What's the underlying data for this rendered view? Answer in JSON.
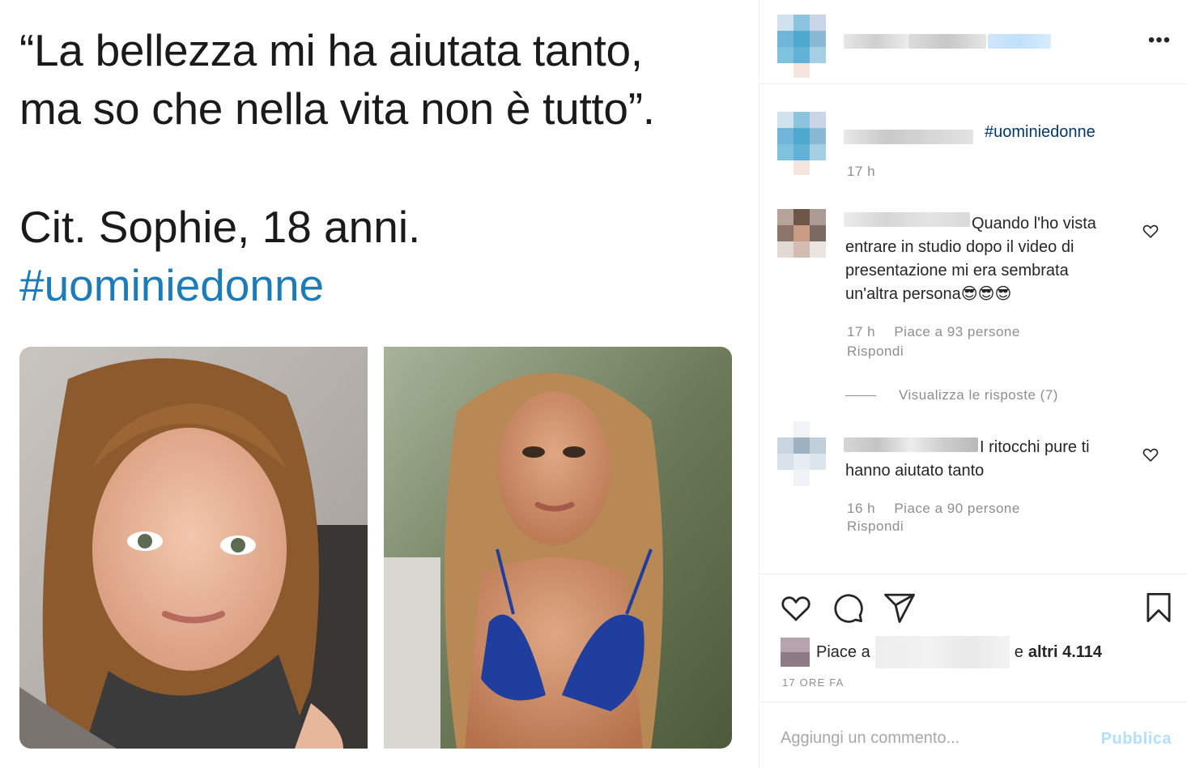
{
  "post": {
    "quote_line1": "“La bellezza mi ha aiutata tanto,",
    "quote_line2": "ma so che nella vita non è tutto”.",
    "citation": "Cit. Sophie, 18 anni.",
    "hashtag": "#uominiedonne",
    "images": [
      "selfie-photo",
      "bikini-photo"
    ]
  },
  "sidebar": {
    "more_icon": "more-options-icon",
    "caption": {
      "hashtag": "#uominiedonne",
      "time": "17 h"
    },
    "comments": [
      {
        "text": "Quando l'ho vista entrare in studio dopo il video di presentazione mi era sembrata un'altra persona😎😎😎",
        "time": "17 h",
        "likes": "Piace a 93 persone",
        "reply": "Rispondi",
        "view_replies": "Visualizza le risposte (7)"
      },
      {
        "text": "I ritocchi pure ti hanno aiutato tanto",
        "time": "16 h",
        "likes": "Piace a 90 persone",
        "reply": "Rispondi"
      }
    ],
    "actions": [
      "heart-icon",
      "comment-icon",
      "share-icon",
      "bookmark-icon"
    ],
    "likes_prefix": "Piace a",
    "likes_suffix_pre": "e",
    "likes_suffix_bold": "altri 4.114",
    "date": "17 ORE FA",
    "comment_placeholder": "Aggiungi un commento...",
    "publish_label": "Pubblica"
  }
}
